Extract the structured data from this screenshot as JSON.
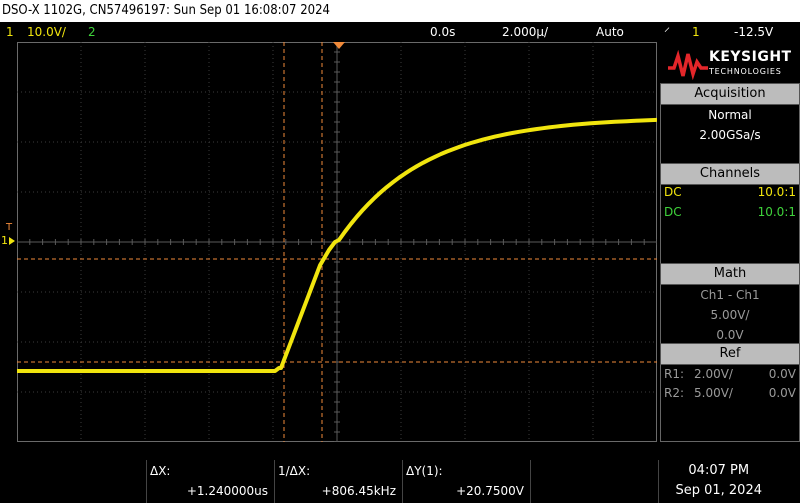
{
  "title": "DSO-X 1102G, CN57496197: Sun Sep 01 16:08:07 2024",
  "status": {
    "ch1_num": "1",
    "ch1_scale": "10.0V/",
    "ch2_num": "2",
    "time_offset": "0.0s",
    "time_scale": "2.000µ/",
    "trigger_mode": "Auto",
    "trigger_channel": "1",
    "trigger_level": "-12.5V"
  },
  "logo": {
    "brand": "KEYSIGHT",
    "sub": "TECHNOLOGIES"
  },
  "acquisition": {
    "header": "Acquisition",
    "mode": "Normal",
    "rate": "2.00GSa/s"
  },
  "channels": {
    "header": "Channels",
    "rows": [
      {
        "coupling": "DC",
        "probe": "10.0:1"
      },
      {
        "coupling": "DC",
        "probe": "10.0:1"
      }
    ]
  },
  "math": {
    "header": "Math",
    "func": "Ch1 - Ch1",
    "scale": "5.00V/",
    "offset": "0.0V"
  },
  "ref": {
    "header": "Ref",
    "rows": [
      {
        "name": "R1:",
        "scale": "2.00V/",
        "offset": "0.0V"
      },
      {
        "name": "R2:",
        "scale": "5.00V/",
        "offset": "0.0V"
      }
    ]
  },
  "measurements": {
    "dx_label": "ΔX:",
    "dx_value": "+1.240000us",
    "inv_dx_label": "1/ΔX:",
    "inv_dx_value": "+806.45kHz",
    "dy_label": "ΔY(1):",
    "dy_value": "+20.7500V"
  },
  "clock": {
    "time": "04:07 PM",
    "date": "Sep 01, 2024"
  },
  "markers": {
    "trigger_marker": "T",
    "ground_marker": "1"
  },
  "colors": {
    "ch1": "#f1e50e",
    "ch2": "#3fd23b",
    "cursor": "#f08a3a",
    "grid": "#3c3c3c"
  }
}
